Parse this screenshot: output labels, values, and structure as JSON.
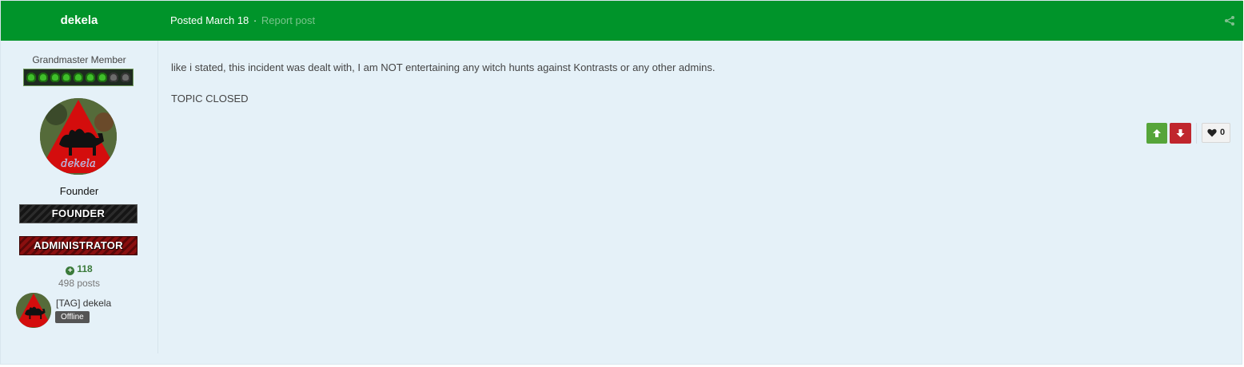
{
  "header": {
    "author": "dekela",
    "posted_label": "Posted March 18",
    "separator": "·",
    "report_label": "Report post",
    "bg_color": "#00942a"
  },
  "sidebar": {
    "group_title": "Grandmaster Member",
    "rank": {
      "filled": 7,
      "total": 9
    },
    "role": "Founder",
    "badges": [
      "FOUNDER",
      "ADMINISTRATOR"
    ],
    "reputation": "118",
    "posts": "498 posts",
    "tag_name": "[TAG] dekela",
    "status": "Offline",
    "avatar_caption": "dekela"
  },
  "content": {
    "paragraphs": [
      "like i stated, this incident was dealt with, I am NOT entertaining any witch hunts against Kontrasts or any other admins.",
      "TOPIC CLOSED"
    ]
  },
  "actions": {
    "like_count": "0",
    "upvote_color": "#56a53a",
    "downvote_color": "#c0262d"
  }
}
